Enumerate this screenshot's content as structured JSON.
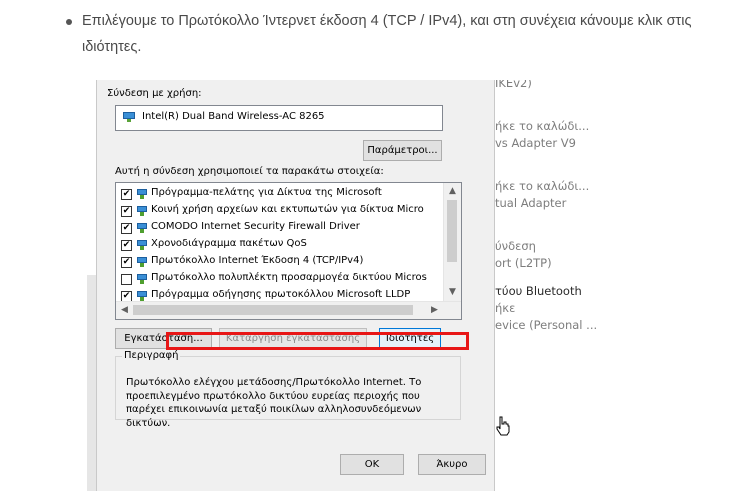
{
  "article": {
    "instruction": "Επιλέγουμε το Πρωτόκολλο Ίντερνετ έκδοση 4 (TCP / IPv4), και στη συνέχεια κάνουμε κλικ στις ιδιότητες."
  },
  "background_items": [
    "IKEv2)",
    "ήκε το καλώδι...",
    "vs Adapter V9",
    "ήκε το καλώδι...",
    "tual Adapter",
    "ύνδεση",
    "ort (L2TP)",
    "τύου Bluetooth",
    "ήκε",
    "evice (Personal ..."
  ],
  "dialog": {
    "connect_using_label": "Σύνδεση με χρήση:",
    "adapter_name": "Intel(R) Dual Band Wireless-AC 8265",
    "configure_button": "Παράμετροι...",
    "items_label": "Αυτή η σύνδεση χρησιμοποιεί τα παρακάτω στοιχεία:",
    "components": [
      {
        "label": "Πρόγραμμα-πελάτης για Δίκτυα της Microsoft",
        "checked": "✔"
      },
      {
        "label": "Κοινή χρήση αρχείων και εκτυπωτών για δίκτυα Micro",
        "checked": "✔"
      },
      {
        "label": "COMODO Internet Security Firewall Driver",
        "checked": "✔"
      },
      {
        "label": "Χρονοδιάγραμμα πακέτων QoS",
        "checked": "✔"
      },
      {
        "label": "Πρωτόκολλο Internet Έκδοση 4 (TCP/IPv4)",
        "checked": "✔"
      },
      {
        "label": "Πρωτόκολλο πολυπλέκτη προσαρμογέα δικτύου Micros",
        "checked": ""
      },
      {
        "label": "Πρόγραμμα οδήγησης πρωτοκόλλου Microsoft LLDP",
        "checked": "✔"
      }
    ],
    "install_button": "Εγκατάσταση...",
    "uninstall_button": "Κατάργηση εγκατάστασης",
    "properties_button": "Ιδιότητες",
    "description_legend": "Περιγραφή",
    "description_text": "Πρωτόκολλο ελέγχου μετάδοσης/Πρωτόκολλο Internet. Το προεπιλεγμένο πρωτόκολλο δικτύου ευρείας περιοχής που παρέχει επικοινωνία μεταξύ ποικίλων αλληλοσυνδεόμενων δικτύων.",
    "ok_button": "OK",
    "cancel_button": "Άκυρο"
  },
  "icons": {
    "scroll_up": "▲",
    "scroll_down": "▼",
    "scroll_left": "◀",
    "scroll_right": "▶"
  },
  "colors": {
    "highlight": "#e81616",
    "focus": "#0078d7"
  }
}
